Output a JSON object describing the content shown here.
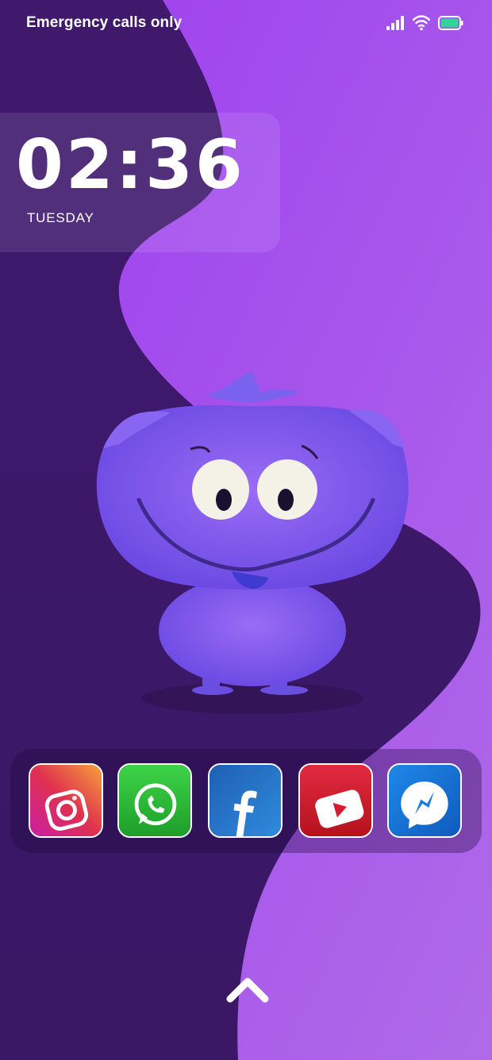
{
  "status_bar": {
    "carrier_text": "Emergency calls only",
    "icons": [
      "signal-icon",
      "wifi-icon",
      "battery-icon"
    ]
  },
  "lock_clock": {
    "time": "02:36",
    "day": "TUESDAY"
  },
  "dock": {
    "apps": [
      {
        "name": "instagram",
        "icon": "instagram-icon"
      },
      {
        "name": "whatsapp",
        "icon": "whatsapp-icon"
      },
      {
        "name": "facebook",
        "icon": "facebook-icon"
      },
      {
        "name": "youtube",
        "icon": "youtube-icon"
      },
      {
        "name": "messenger",
        "icon": "messenger-icon"
      }
    ]
  },
  "swipe_hint": {
    "icon": "chevron-up-icon"
  },
  "colors": {
    "wallpaper_light": "#a24cf0",
    "wallpaper_dark": "#3f1a6e",
    "battery": "#34d399"
  }
}
